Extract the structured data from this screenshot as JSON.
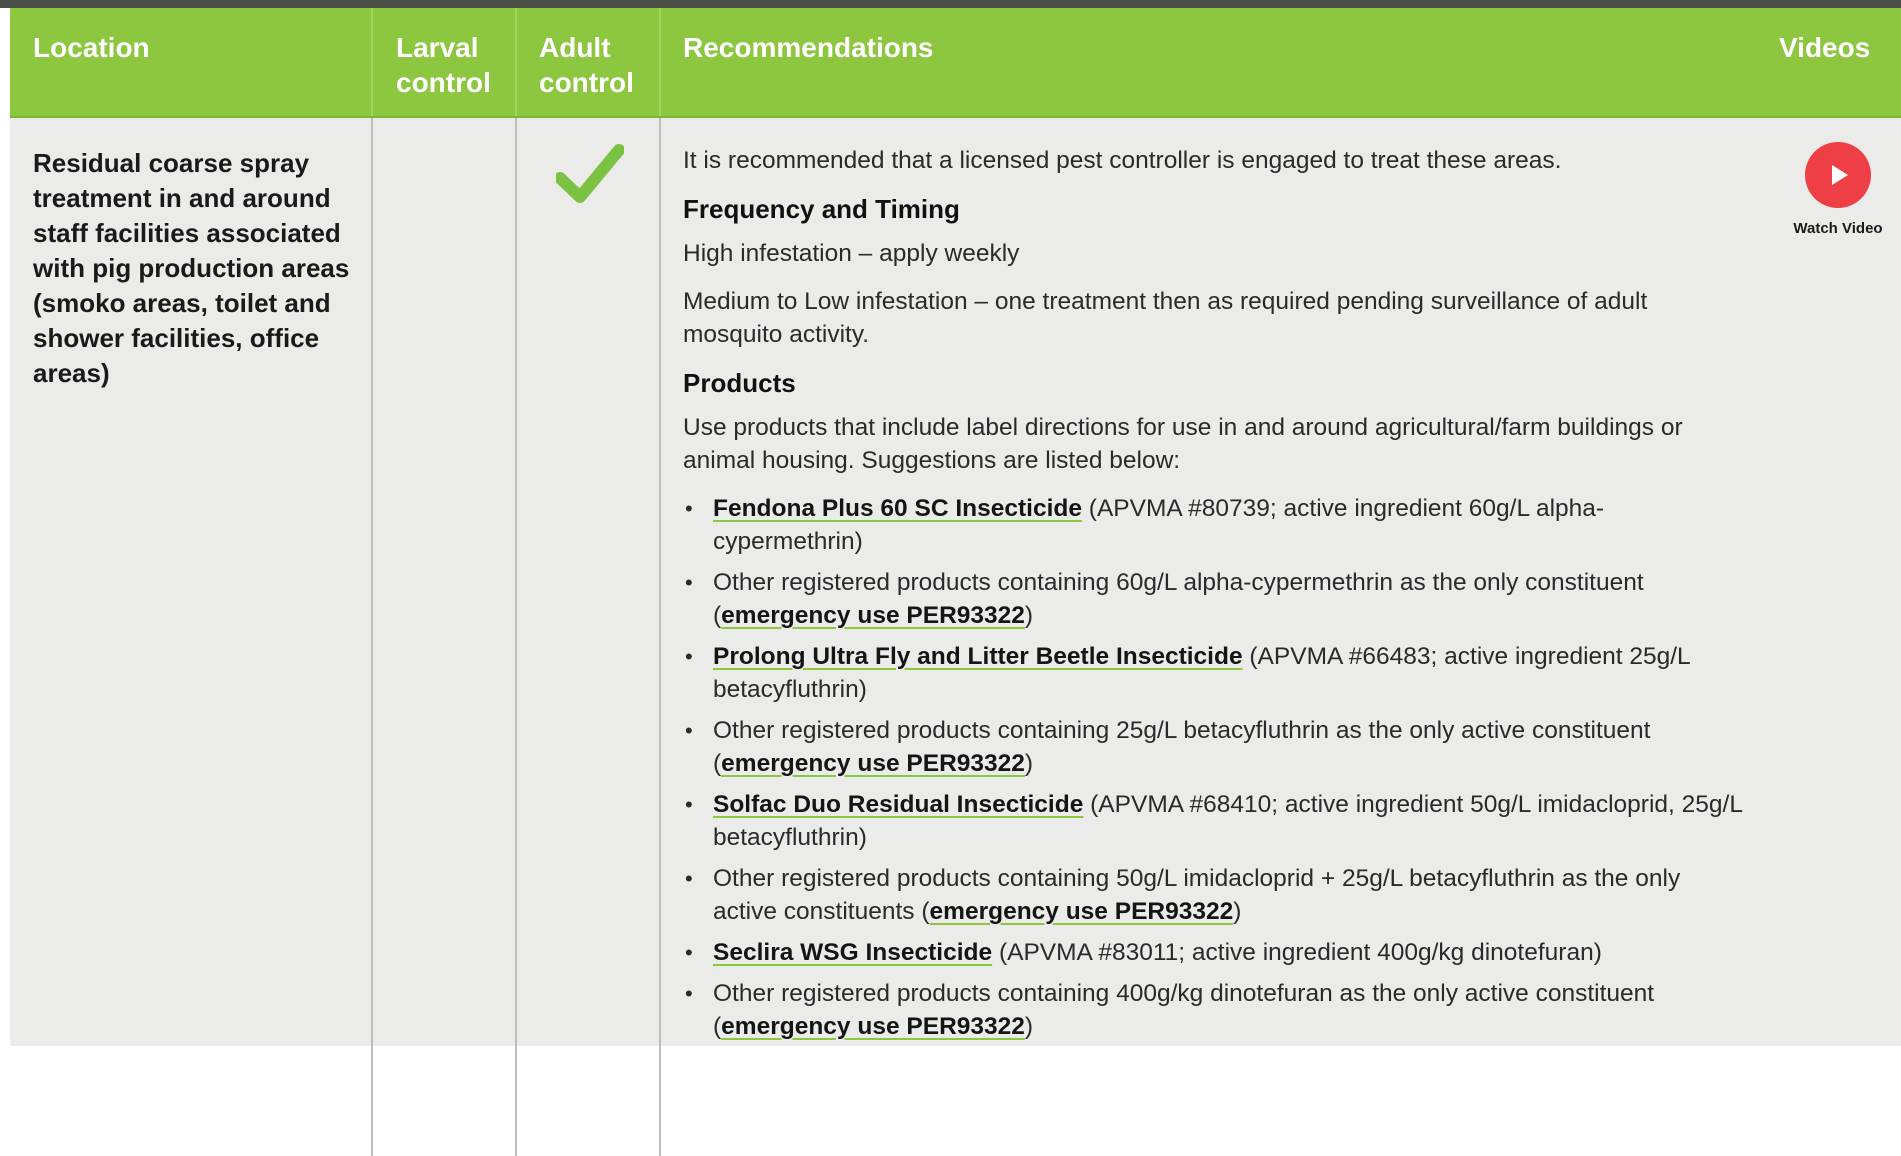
{
  "header": {
    "location": "Location",
    "larval": "Larval control",
    "adult": "Adult control",
    "recommendations": "Recommendations",
    "videos": "Videos"
  },
  "row": {
    "location": "Residual coarse spray treatment in and around staff facilities associated with pig production areas (smoko areas, toilet and shower facilities, office areas)",
    "larval_control": false,
    "adult_control": true,
    "intro": "It is recommended that a licensed pest controller is engaged to treat these areas.",
    "frequency_heading": "Frequency and Timing",
    "frequency": [
      "High infestation – apply weekly",
      "Medium to Low infestation – one treatment then as required pending surveillance of adult mosquito activity."
    ],
    "products_heading": "Products",
    "products_intro": "Use products that include label directions for use in and around agricultural/farm buildings or animal housing. Suggestions are listed below:",
    "products": [
      {
        "link": "Fendona Plus 60 SC Insecticide",
        "text": " (APVMA #80739; active ingredient 60g/L alpha-cypermethrin)"
      },
      {
        "pre": "Other registered products containing 60g/L alpha-cypermethrin as the only constituent (",
        "link": "emergency use PER93322",
        "post": ")"
      },
      {
        "link": "Prolong Ultra Fly and Litter Beetle Insecticide",
        "text": " (APVMA #66483; active ingredient 25g/L betacyfluthrin)"
      },
      {
        "pre": "Other registered products containing 25g/L betacyfluthrin as the only active constituent (",
        "link": "emergency use PER93322",
        "post": ")"
      },
      {
        "link": "Solfac Duo Residual Insecticide",
        "text": " (APVMA #68410; active ingredient 50g/L imidacloprid, 25g/L betacyfluthrin)"
      },
      {
        "pre": "Other registered products containing 50g/L imidacloprid + 25g/L betacyfluthrin as the only active constituents (",
        "link": "emergency use PER93322",
        "post": ")"
      },
      {
        "link": "Seclira WSG Insecticide",
        "text": " (APVMA #83011; active ingredient 400g/kg dinotefuran)"
      },
      {
        "pre": "Other registered products containing 400g/kg dinotefuran as the only active constituent (",
        "link": "emergency use PER93322",
        "post": ")"
      }
    ],
    "video": {
      "label": "Watch Video",
      "icon": "play-icon"
    }
  },
  "colors": {
    "header_bg": "#8dc63f",
    "body_bg": "#ebebea",
    "play_button": "#ee3f46",
    "check": "#7cc242",
    "link_underline": "#8dc63f"
  }
}
